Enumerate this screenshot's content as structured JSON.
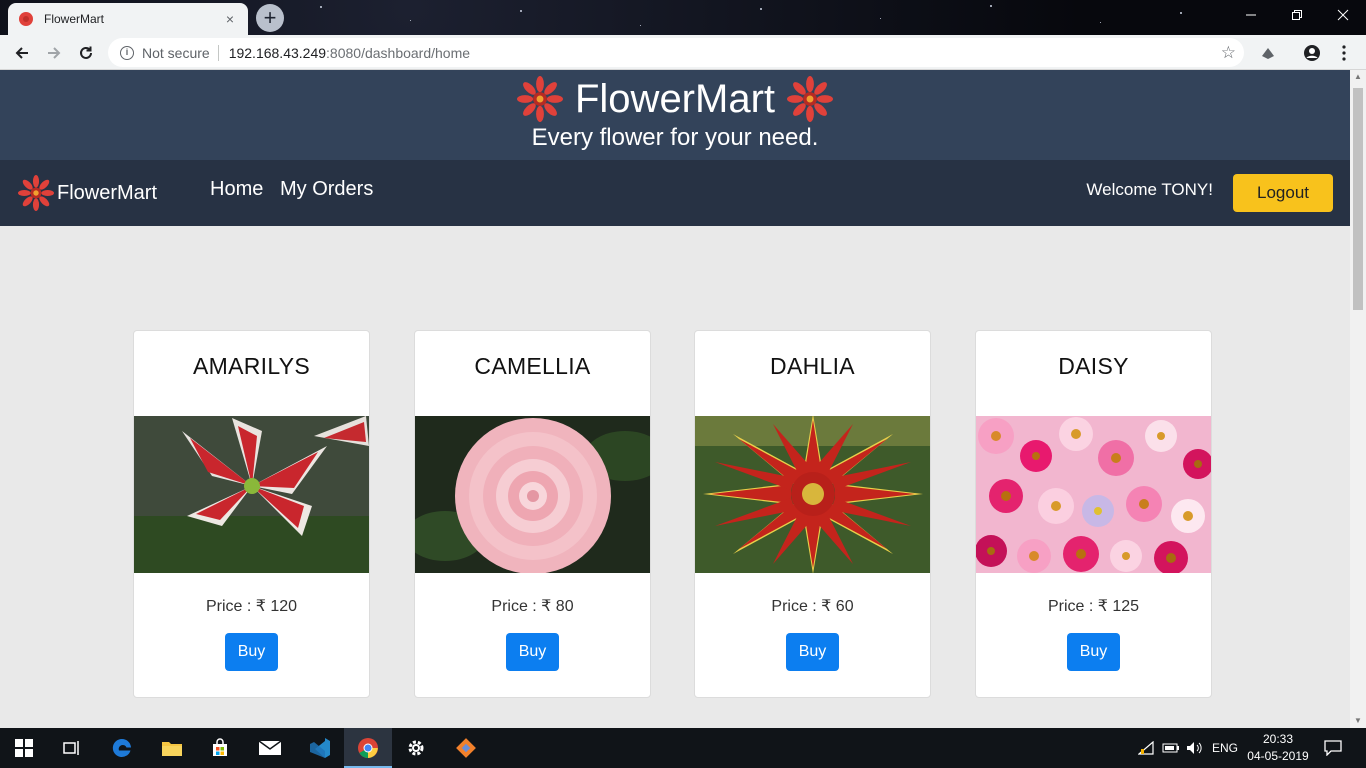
{
  "browser": {
    "tab_title": "FlowerMart",
    "tab_close": "×",
    "new_tab": "+",
    "security_label": "Not secure",
    "url_host": "192.168.43.249",
    "url_path": ":8080/dashboard/home"
  },
  "hero": {
    "title": "FlowerMart",
    "tagline": "Every flower for your need."
  },
  "navbar": {
    "brand": "FlowerMart",
    "links": [
      "Home",
      "My Orders"
    ],
    "welcome": "Welcome TONY!",
    "logout_label": "Logout"
  },
  "products": [
    {
      "name": "AMARILYS",
      "price": "Price : ₹ 120",
      "buy_label": "Buy"
    },
    {
      "name": "CAMELLIA",
      "price": "Price : ₹ 80",
      "buy_label": "Buy"
    },
    {
      "name": "DAHLIA",
      "price": "Price : ₹ 60",
      "buy_label": "Buy"
    },
    {
      "name": "DAISY",
      "price": "Price : ₹ 125",
      "buy_label": "Buy"
    }
  ],
  "taskbar": {
    "language": "ENG",
    "time": "20:33",
    "date": "04-05-2019"
  },
  "colors": {
    "hero_bg": "#33435a",
    "navbar_bg": "#273244",
    "logout_bg": "#f8c21c",
    "buy_bg": "#0c7ef0",
    "page_bg": "#e9e9e9"
  }
}
